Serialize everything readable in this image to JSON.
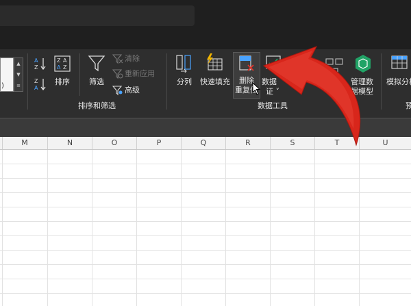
{
  "ribbon": {
    "sort_asc": "A↓Z",
    "sort": "排序",
    "filter": "筛选",
    "clear": "清除",
    "reapply": "重新应用",
    "advanced": "高级",
    "group_sort_filter": "排序和筛选",
    "text_to_columns": "分列",
    "flash_fill": "快速填充",
    "remove_duplicates_line1": "删除",
    "remove_duplicates_line2": "重复值",
    "data_validation_line1": "数据",
    "data_validation_line2": "证 ˅",
    "manage_model_line1": "管理数",
    "manage_model_line2": "据模型",
    "what_if": "模拟分析",
    "group_data_tools": "数据工具",
    "partial_right_label": "预"
  },
  "columns": [
    "M",
    "N",
    "O",
    "P",
    "Q",
    "R",
    "S",
    "T",
    "U"
  ],
  "colors": {
    "ribbon_bg": "#2e2e2e",
    "title_bg": "#1f1f1f",
    "arrow_red": "#d8261b",
    "accent_blue": "#4aa3ff",
    "accent_green": "#21a366"
  }
}
